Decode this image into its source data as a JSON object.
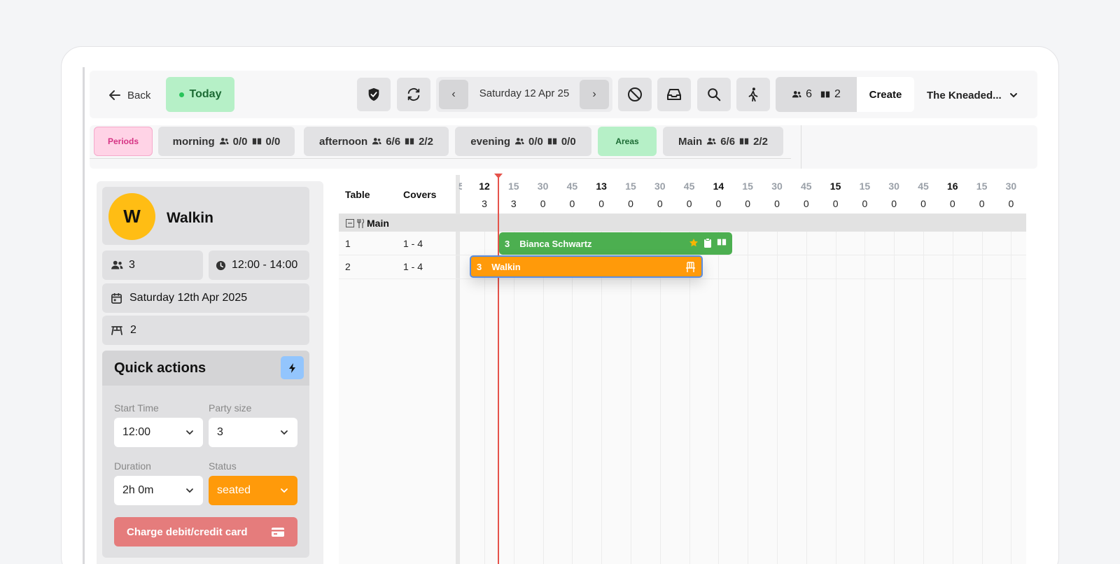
{
  "toolbar": {
    "back_label": "Back",
    "today_label": "Today",
    "date_label": "Saturday 12 Apr 25",
    "prev_label": "‹",
    "next_label": "›",
    "covers_count": "6",
    "bookings_count": "2",
    "create_label": "Create",
    "venue_label": "The Kneaded..."
  },
  "periods": {
    "label": "Periods",
    "items": [
      {
        "name": "morning",
        "covers": "0/0",
        "bookings": "0/0"
      },
      {
        "name": "afternoon",
        "covers": "6/6",
        "bookings": "2/2"
      },
      {
        "name": "evening",
        "covers": "0/0",
        "bookings": "0/0"
      }
    ]
  },
  "areas": {
    "label": "Areas",
    "items": [
      {
        "name": "Main",
        "covers": "6/6",
        "bookings": "2/2"
      }
    ]
  },
  "guest": {
    "initial": "W",
    "name": "Walkin",
    "party_size": "3",
    "time_range": "12:00 - 14:00",
    "date": "Saturday 12th Apr 2025",
    "table": "2"
  },
  "quick_actions": {
    "title": "Quick actions",
    "start_time_label": "Start Time",
    "start_time_value": "12:00",
    "party_size_label": "Party size",
    "party_size_value": "3",
    "duration_label": "Duration",
    "duration_value": "2h 0m",
    "status_label": "Status",
    "status_value": "seated",
    "charge_label": "Charge debit/credit card"
  },
  "grid": {
    "table_header": "Table",
    "covers_header": "Covers",
    "partial_label": "5",
    "slots": [
      {
        "label": "12",
        "hour": true,
        "count": "3"
      },
      {
        "label": "15",
        "hour": false,
        "count": "3"
      },
      {
        "label": "30",
        "hour": false,
        "count": "0"
      },
      {
        "label": "45",
        "hour": false,
        "count": "0"
      },
      {
        "label": "13",
        "hour": true,
        "count": "0"
      },
      {
        "label": "15",
        "hour": false,
        "count": "0"
      },
      {
        "label": "30",
        "hour": false,
        "count": "0"
      },
      {
        "label": "45",
        "hour": false,
        "count": "0"
      },
      {
        "label": "14",
        "hour": true,
        "count": "0"
      },
      {
        "label": "15",
        "hour": false,
        "count": "0"
      },
      {
        "label": "30",
        "hour": false,
        "count": "0"
      },
      {
        "label": "45",
        "hour": false,
        "count": "0"
      },
      {
        "label": "15",
        "hour": true,
        "count": "0"
      },
      {
        "label": "15",
        "hour": false,
        "count": "0"
      },
      {
        "label": "30",
        "hour": false,
        "count": "0"
      },
      {
        "label": "45",
        "hour": false,
        "count": "0"
      },
      {
        "label": "16",
        "hour": true,
        "count": "0"
      },
      {
        "label": "15",
        "hour": false,
        "count": "0"
      },
      {
        "label": "30",
        "hour": false,
        "count": "0"
      }
    ],
    "section_label": "Main",
    "rows": [
      {
        "table": "1",
        "covers": "1 - 4"
      },
      {
        "table": "2",
        "covers": "1 - 4"
      }
    ],
    "reservations": [
      {
        "covers": "3",
        "name": "Bianca Schwartz",
        "color": "#4caf50"
      },
      {
        "covers": "3",
        "name": "Walkin",
        "color": "#ff9a0a"
      }
    ]
  }
}
